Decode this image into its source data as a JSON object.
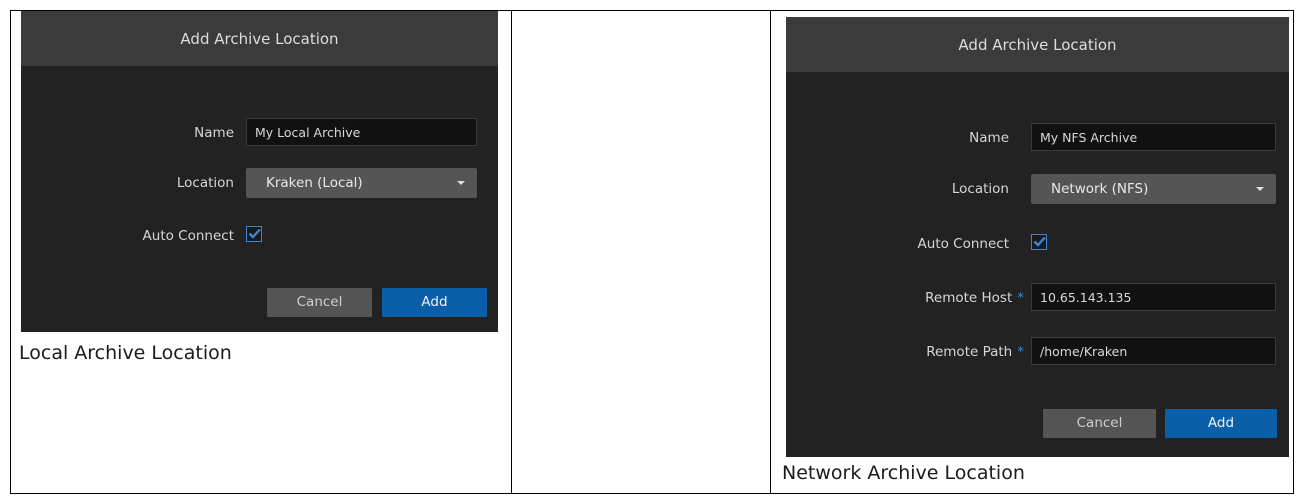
{
  "local_dialog": {
    "title": "Add Archive Location",
    "name_label": "Name",
    "name_value": "My Local Archive",
    "location_label": "Location",
    "location_value": "Kraken (Local)",
    "auto_connect_label": "Auto Connect",
    "auto_connect_checked": true,
    "cancel_label": "Cancel",
    "add_label": "Add"
  },
  "local_caption": "Local Archive Location",
  "network_dialog": {
    "title": "Add Archive Location",
    "name_label": "Name",
    "name_value": "My NFS Archive",
    "location_label": "Location",
    "location_value": "Network (NFS)",
    "auto_connect_label": "Auto Connect",
    "auto_connect_checked": true,
    "remote_host_label": "Remote Host",
    "remote_host_value": "10.65.143.135",
    "remote_path_label": "Remote Path",
    "remote_path_value": "/home/Kraken",
    "required_marker": "*",
    "cancel_label": "Cancel",
    "add_label": "Add"
  },
  "network_caption": "Network Archive Location",
  "colors": {
    "dialog_bg": "#222222",
    "header_bg": "#3b3b3b",
    "accent": "#0b5ea8",
    "checkbox": "#3a86d4"
  },
  "icons": {
    "checkbox": "checkmark-icon",
    "dropdown": "chevron-down-icon"
  }
}
